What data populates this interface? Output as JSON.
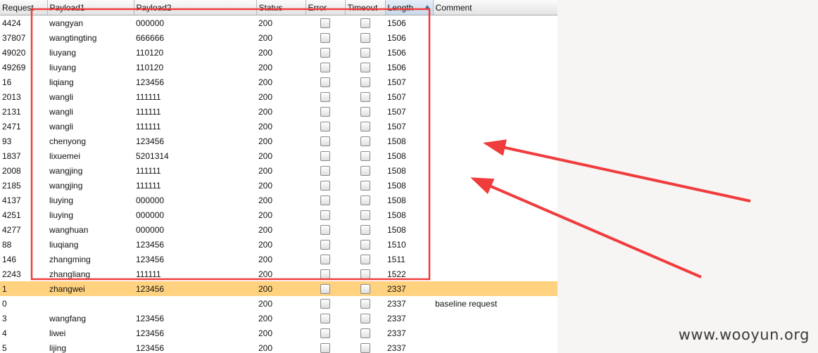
{
  "columns": [
    "Request",
    "Payload1",
    "Payload2",
    "Status",
    "Error",
    "Timeout",
    "Length",
    "Comment"
  ],
  "rows": [
    {
      "request": "4424",
      "payload1": "wangyan",
      "payload2": "000000",
      "status": "200",
      "length": "1506",
      "comment": ""
    },
    {
      "request": "37807",
      "payload1": "wangtingting",
      "payload2": "666666",
      "status": "200",
      "length": "1506",
      "comment": ""
    },
    {
      "request": "49020",
      "payload1": "liuyang",
      "payload2": "110120",
      "status": "200",
      "length": "1506",
      "comment": ""
    },
    {
      "request": "49269",
      "payload1": "liuyang",
      "payload2": "110120",
      "status": "200",
      "length": "1506",
      "comment": ""
    },
    {
      "request": "16",
      "payload1": "liqiang",
      "payload2": "123456",
      "status": "200",
      "length": "1507",
      "comment": ""
    },
    {
      "request": "2013",
      "payload1": "wangli",
      "payload2": "111111",
      "status": "200",
      "length": "1507",
      "comment": ""
    },
    {
      "request": "2131",
      "payload1": "wangli",
      "payload2": "111111",
      "status": "200",
      "length": "1507",
      "comment": ""
    },
    {
      "request": "2471",
      "payload1": "wangli",
      "payload2": "111111",
      "status": "200",
      "length": "1507",
      "comment": ""
    },
    {
      "request": "93",
      "payload1": "chenyong",
      "payload2": "123456",
      "status": "200",
      "length": "1508",
      "comment": ""
    },
    {
      "request": "1837",
      "payload1": "lixuemei",
      "payload2": "5201314",
      "status": "200",
      "length": "1508",
      "comment": ""
    },
    {
      "request": "2008",
      "payload1": "wangjing",
      "payload2": "111111",
      "status": "200",
      "length": "1508",
      "comment": ""
    },
    {
      "request": "2185",
      "payload1": "wangjing",
      "payload2": "111111",
      "status": "200",
      "length": "1508",
      "comment": ""
    },
    {
      "request": "4137",
      "payload1": "liuying",
      "payload2": "000000",
      "status": "200",
      "length": "1508",
      "comment": ""
    },
    {
      "request": "4251",
      "payload1": "liuying",
      "payload2": "000000",
      "status": "200",
      "length": "1508",
      "comment": ""
    },
    {
      "request": "4277",
      "payload1": "wanghuan",
      "payload2": "000000",
      "status": "200",
      "length": "1508",
      "comment": ""
    },
    {
      "request": "88",
      "payload1": "liuqiang",
      "payload2": "123456",
      "status": "200",
      "length": "1510",
      "comment": ""
    },
    {
      "request": "146",
      "payload1": "zhangming",
      "payload2": "123456",
      "status": "200",
      "length": "1511",
      "comment": ""
    },
    {
      "request": "2243",
      "payload1": "zhangliang",
      "payload2": "111111",
      "status": "200",
      "length": "1522",
      "comment": ""
    },
    {
      "request": "1",
      "payload1": "zhangwei",
      "payload2": "123456",
      "status": "200",
      "length": "2337",
      "comment": "",
      "highlighted": true
    },
    {
      "request": "0",
      "payload1": "",
      "payload2": "",
      "status": "200",
      "length": "2337",
      "comment": "baseline request"
    },
    {
      "request": "3",
      "payload1": "wangfang",
      "payload2": "123456",
      "status": "200",
      "length": "2337",
      "comment": ""
    },
    {
      "request": "4",
      "payload1": "liwei",
      "payload2": "123456",
      "status": "200",
      "length": "2337",
      "comment": ""
    },
    {
      "request": "5",
      "payload1": "lijing",
      "payload2": "123456",
      "status": "200",
      "length": "2337",
      "comment": ""
    }
  ],
  "sort": {
    "column": "Length",
    "direction": "ascending"
  },
  "colors": {
    "highlight_row": "#ffd27f",
    "annotation": "#f03c3c"
  },
  "watermark": "www.wooyun.org"
}
